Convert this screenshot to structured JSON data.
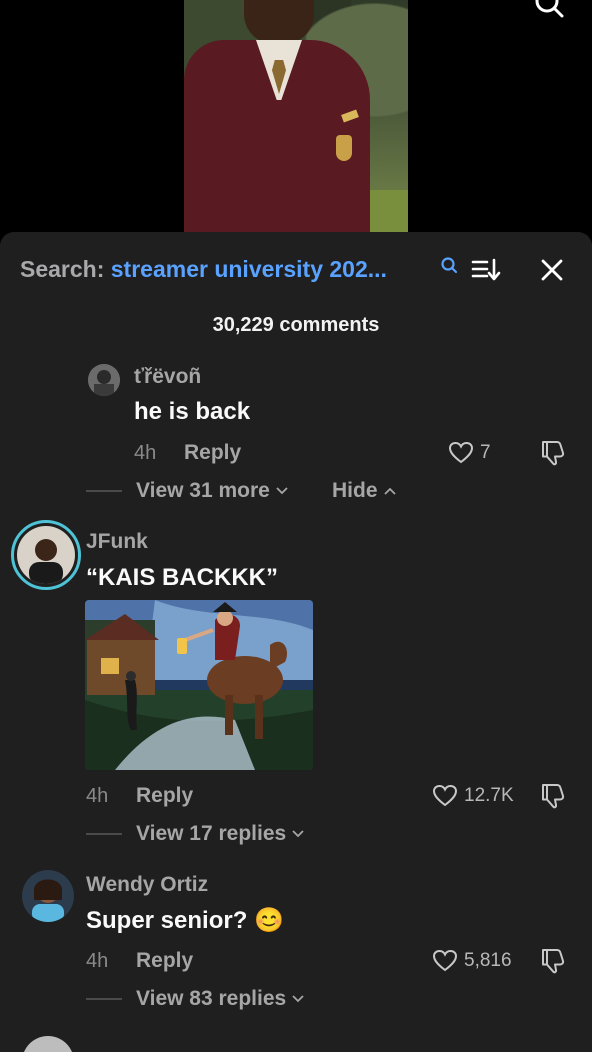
{
  "header": {
    "search_prefix": "Search: ",
    "search_query": "streamer university 202...",
    "comment_count": "30,229 comments"
  },
  "comments": [
    {
      "author": "ťřëvoñ",
      "text": "he is back",
      "time": "4h",
      "reply": "Reply",
      "likes": "7",
      "view_more": "View 31 more",
      "hide": "Hide"
    },
    {
      "author": "JFunk",
      "text": "“KAIS BACKKK”",
      "time": "4h",
      "reply": "Reply",
      "likes": "12.7K",
      "view_more": "View 17 replies"
    },
    {
      "author": "Wendy Ortiz",
      "text": "Super senior? 😊",
      "time": "4h",
      "reply": "Reply",
      "likes": "5,816",
      "view_more": "View 83 replies"
    }
  ],
  "colors": {
    "sheet_bg": "#1f1f1f",
    "query_blue": "#5aa2ff",
    "muted": "#a6a6a6"
  },
  "icons": [
    "search-icon",
    "sort-icon",
    "close-icon",
    "heart-icon",
    "dislike-icon",
    "chevron-down-icon",
    "chevron-up-icon"
  ]
}
